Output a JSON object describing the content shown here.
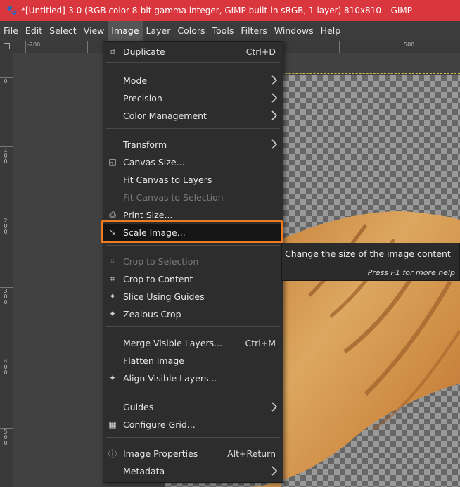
{
  "window": {
    "title": "*[Untitled]-3.0 (RGB color 8-bit gamma integer, GIMP built-in sRGB, 1 layer) 810x810 – GIMP",
    "logo_icon": "gimp-wilber-icon"
  },
  "menubar": {
    "items": [
      "File",
      "Edit",
      "Select",
      "View",
      "Image",
      "Layer",
      "Colors",
      "Tools",
      "Filters",
      "Windows",
      "Help"
    ],
    "active": "Image"
  },
  "rulers": {
    "h_labels": [
      "-200",
      "500"
    ],
    "v_labels": [
      "0",
      "100",
      "200",
      "300",
      "400",
      "500"
    ]
  },
  "image_menu": {
    "items": [
      {
        "label": "Duplicate",
        "shortcut": "Ctrl+D",
        "icon": "duplicate-icon"
      },
      {
        "label": "Mode",
        "submenu": true
      },
      {
        "label": "Precision",
        "submenu": true
      },
      {
        "label": "Color Management",
        "submenu": true
      },
      {
        "label": "Transform",
        "submenu": true
      },
      {
        "label": "Canvas Size...",
        "icon": "canvas-size-icon"
      },
      {
        "label": "Fit Canvas to Layers"
      },
      {
        "label": "Fit Canvas to Selection",
        "disabled": true
      },
      {
        "label": "Print Size...",
        "icon": "printer-icon"
      },
      {
        "label": "Scale Image...",
        "icon": "scale-image-icon",
        "highlighted": true
      },
      {
        "label": "Crop to Selection",
        "icon": "crop-icon",
        "disabled": true
      },
      {
        "label": "Crop to Content",
        "icon": "crop-icon"
      },
      {
        "label": "Slice Using Guides",
        "icon": "slice-icon"
      },
      {
        "label": "Zealous Crop",
        "icon": "zealous-crop-icon"
      },
      {
        "label": "Merge Visible Layers...",
        "shortcut": "Ctrl+M"
      },
      {
        "label": "Flatten Image"
      },
      {
        "label": "Align Visible Layers...",
        "icon": "align-icon"
      },
      {
        "label": "Guides",
        "submenu": true
      },
      {
        "label": "Configure Grid...",
        "icon": "grid-icon"
      },
      {
        "label": "Image Properties",
        "shortcut": "Alt+Return",
        "icon": "info-icon"
      },
      {
        "label": "Metadata",
        "submenu": true
      }
    ]
  },
  "tooltip": {
    "text": "Change the size of the image content",
    "help": "Press F1 for more help"
  },
  "colors": {
    "titlebar": "#d9363e",
    "highlight_outline": "#f07c22",
    "menu_bg": "#2d2d2d"
  }
}
